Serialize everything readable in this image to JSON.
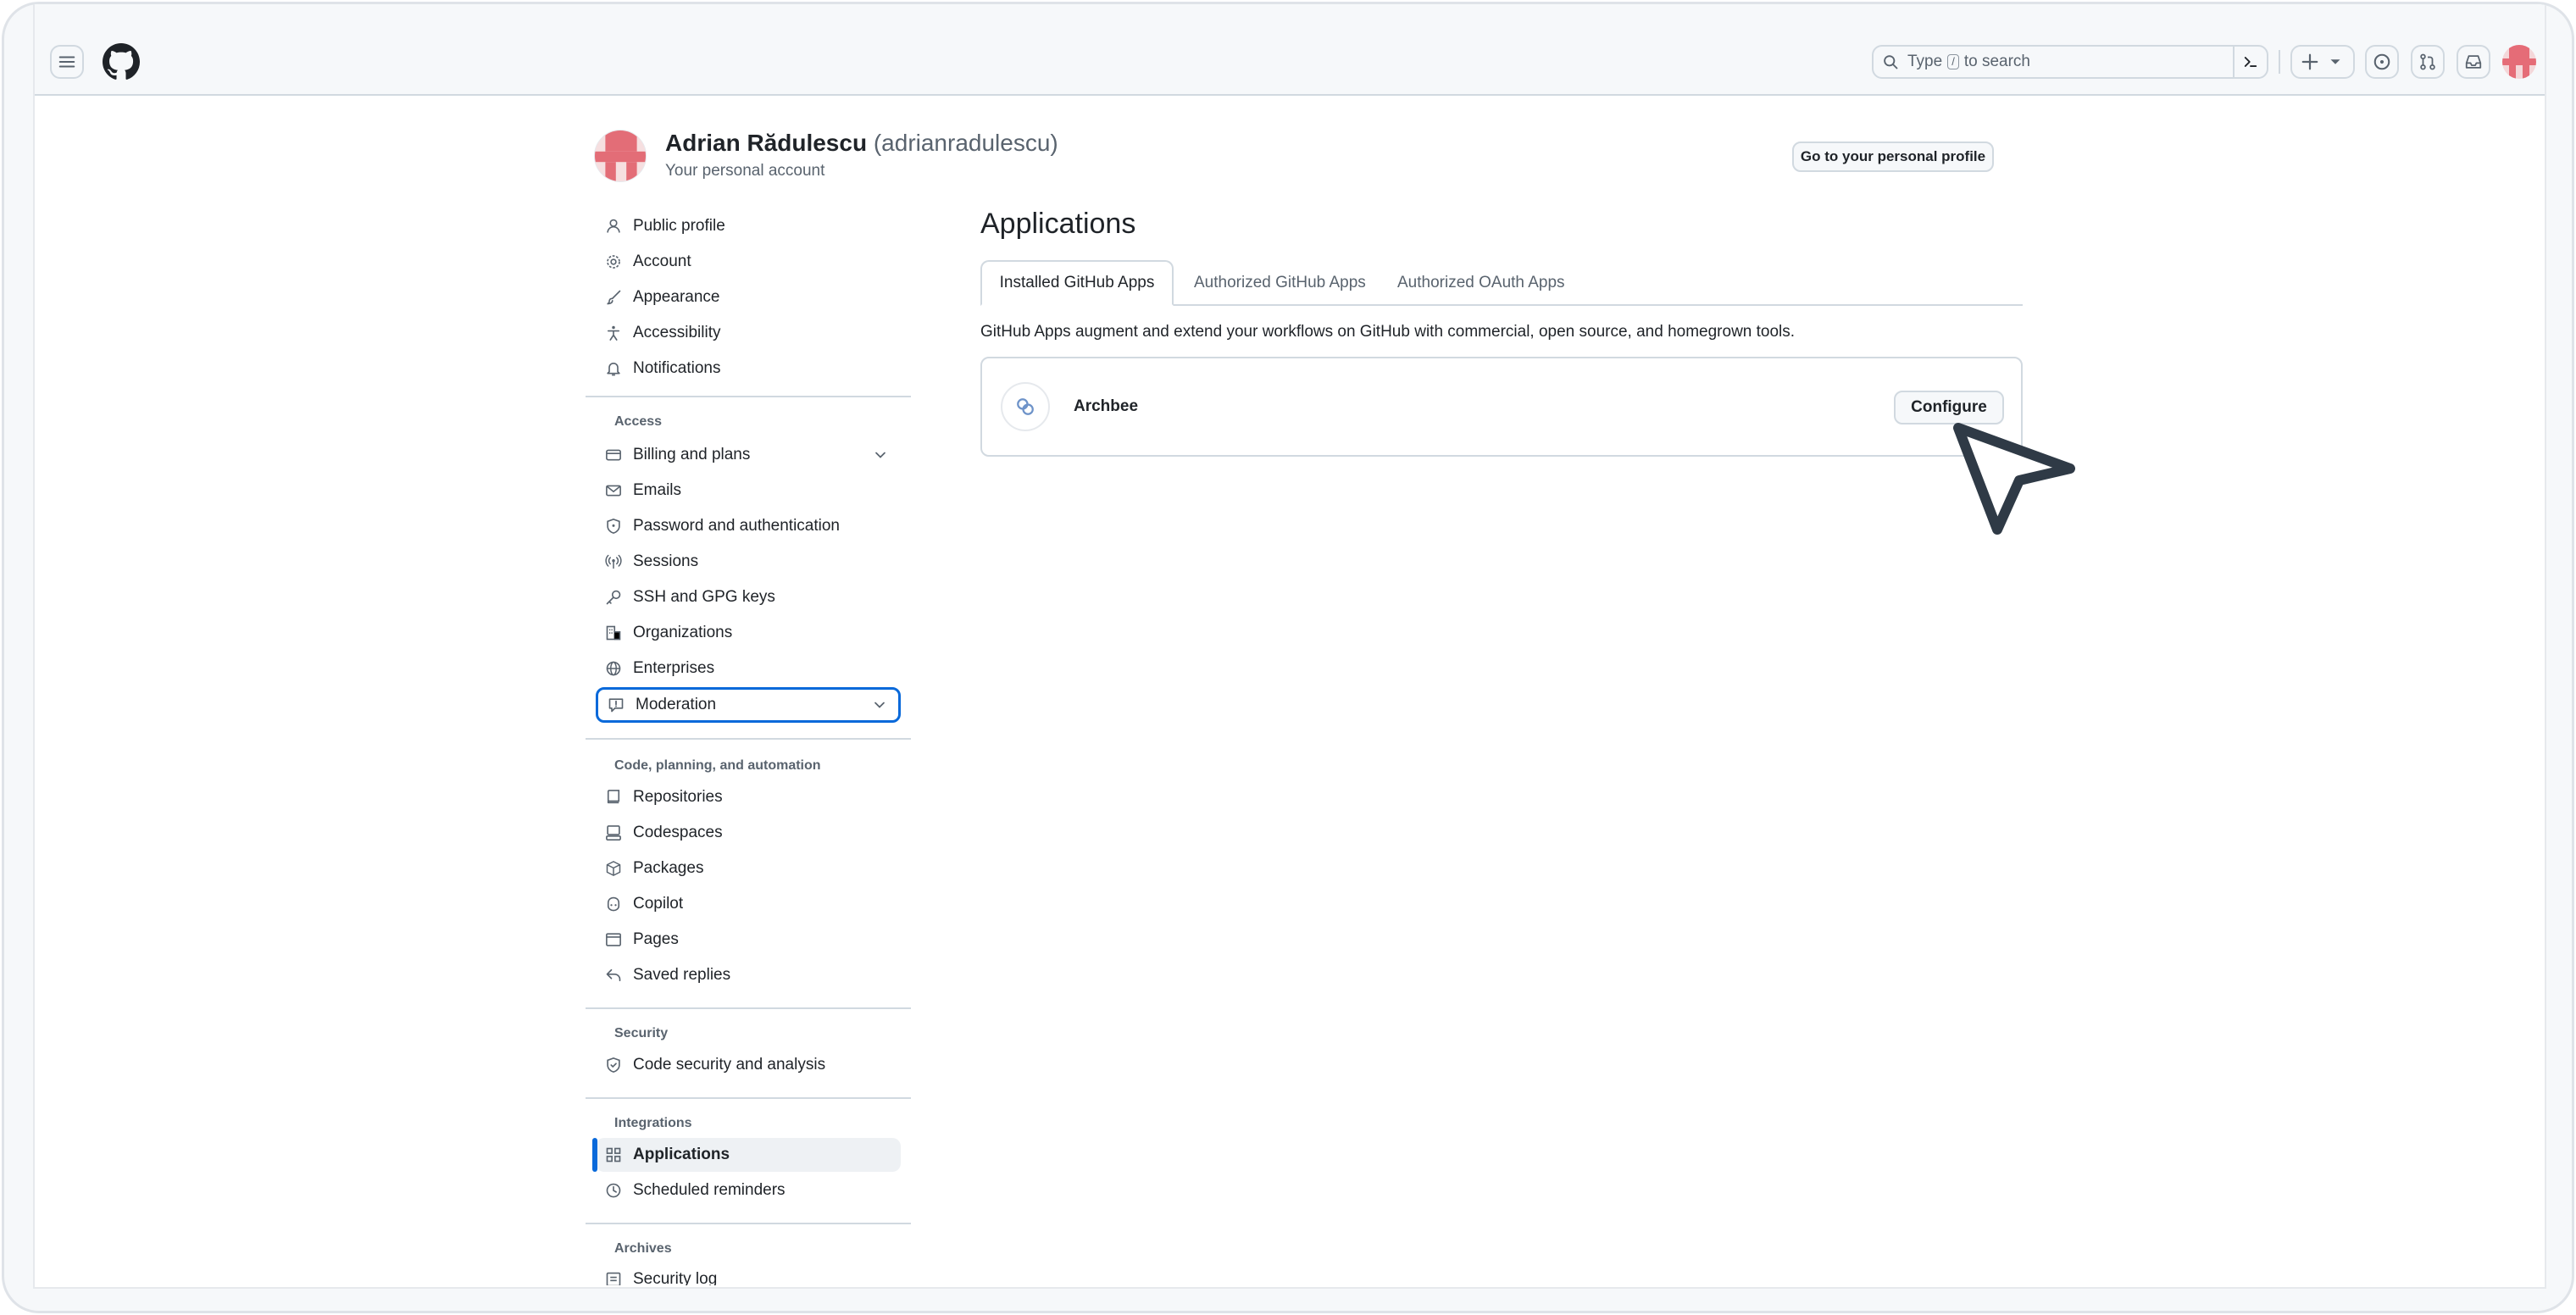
{
  "header": {
    "search_prefix": "Type",
    "search_key": "/",
    "search_suffix": "to search"
  },
  "profile": {
    "name": "Adrian Rădulescu",
    "login": "(adrianradulescu)",
    "subtitle": "Your personal account",
    "go_profile_label": "Go to your personal profile"
  },
  "sidebar": {
    "top_items": [
      {
        "label": "Public profile",
        "icon": "person-icon"
      },
      {
        "label": "Account",
        "icon": "gear-icon"
      },
      {
        "label": "Appearance",
        "icon": "paintbrush-icon"
      },
      {
        "label": "Accessibility",
        "icon": "accessibility-icon"
      },
      {
        "label": "Notifications",
        "icon": "bell-icon"
      }
    ],
    "sections": {
      "access": "Access",
      "code": "Code, planning, and automation",
      "security": "Security",
      "integrations": "Integrations",
      "archives": "Archives"
    },
    "access_items": [
      {
        "label": "Billing and plans",
        "icon": "credit-card-icon"
      },
      {
        "label": "Emails",
        "icon": "mail-icon"
      },
      {
        "label": "Password and authentication",
        "icon": "shield-lock-icon"
      },
      {
        "label": "Sessions",
        "icon": "broadcast-icon"
      },
      {
        "label": "SSH and GPG keys",
        "icon": "key-icon"
      },
      {
        "label": "Organizations",
        "icon": "organization-icon"
      },
      {
        "label": "Enterprises",
        "icon": "globe-icon"
      },
      {
        "label": "Moderation",
        "icon": "report-icon"
      }
    ],
    "code_items": [
      {
        "label": "Repositories",
        "icon": "repo-icon"
      },
      {
        "label": "Codespaces",
        "icon": "codespaces-icon"
      },
      {
        "label": "Packages",
        "icon": "package-icon"
      },
      {
        "label": "Copilot",
        "icon": "copilot-icon"
      },
      {
        "label": "Pages",
        "icon": "browser-icon"
      },
      {
        "label": "Saved replies",
        "icon": "reply-icon"
      }
    ],
    "security_items": [
      {
        "label": "Code security and analysis",
        "icon": "shield-check-icon"
      }
    ],
    "integration_items": [
      {
        "label": "Applications",
        "icon": "apps-icon"
      },
      {
        "label": "Scheduled reminders",
        "icon": "clock-icon"
      }
    ],
    "archive_items": [
      {
        "label": "Security log",
        "icon": "log-icon"
      }
    ]
  },
  "main": {
    "title": "Applications",
    "tabs": [
      {
        "label": "Installed GitHub Apps"
      },
      {
        "label": "Authorized GitHub Apps"
      },
      {
        "label": "Authorized OAuth Apps"
      }
    ],
    "description": "GitHub Apps augment and extend your workflows on GitHub with commercial, open source, and homegrown tools.",
    "apps": [
      {
        "name": "Archbee",
        "button": "Configure"
      }
    ]
  },
  "colors": {
    "accent": "#0969da",
    "border": "#d1d9e0",
    "muted_text": "#59636e"
  }
}
